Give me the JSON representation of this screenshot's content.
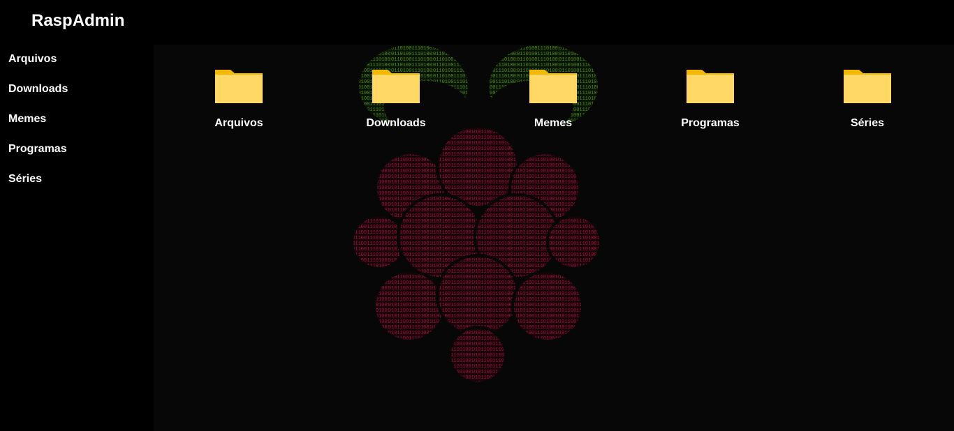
{
  "app": {
    "title": "RaspAdmin"
  },
  "sidebar": {
    "items": [
      {
        "label": "Arquivos"
      },
      {
        "label": "Downloads"
      },
      {
        "label": "Memes"
      },
      {
        "label": "Programas"
      },
      {
        "label": "Séries"
      }
    ]
  },
  "folders": [
    {
      "label": "Arquivos",
      "icon": "folder-icon"
    },
    {
      "label": "Downloads",
      "icon": "folder-icon"
    },
    {
      "label": "Memes",
      "icon": "folder-icon"
    },
    {
      "label": "Programas",
      "icon": "folder-icon"
    },
    {
      "label": "Séries",
      "icon": "folder-icon"
    }
  ],
  "background": {
    "logo": "raspberry-pi-logo"
  },
  "colors": {
    "background": "#000000",
    "main_background": "#070707",
    "folder_body": "#FFD866",
    "folder_tab": "#F5B800",
    "logo_berry": "#8A1038",
    "logo_leaves": "#3F7A1A"
  }
}
